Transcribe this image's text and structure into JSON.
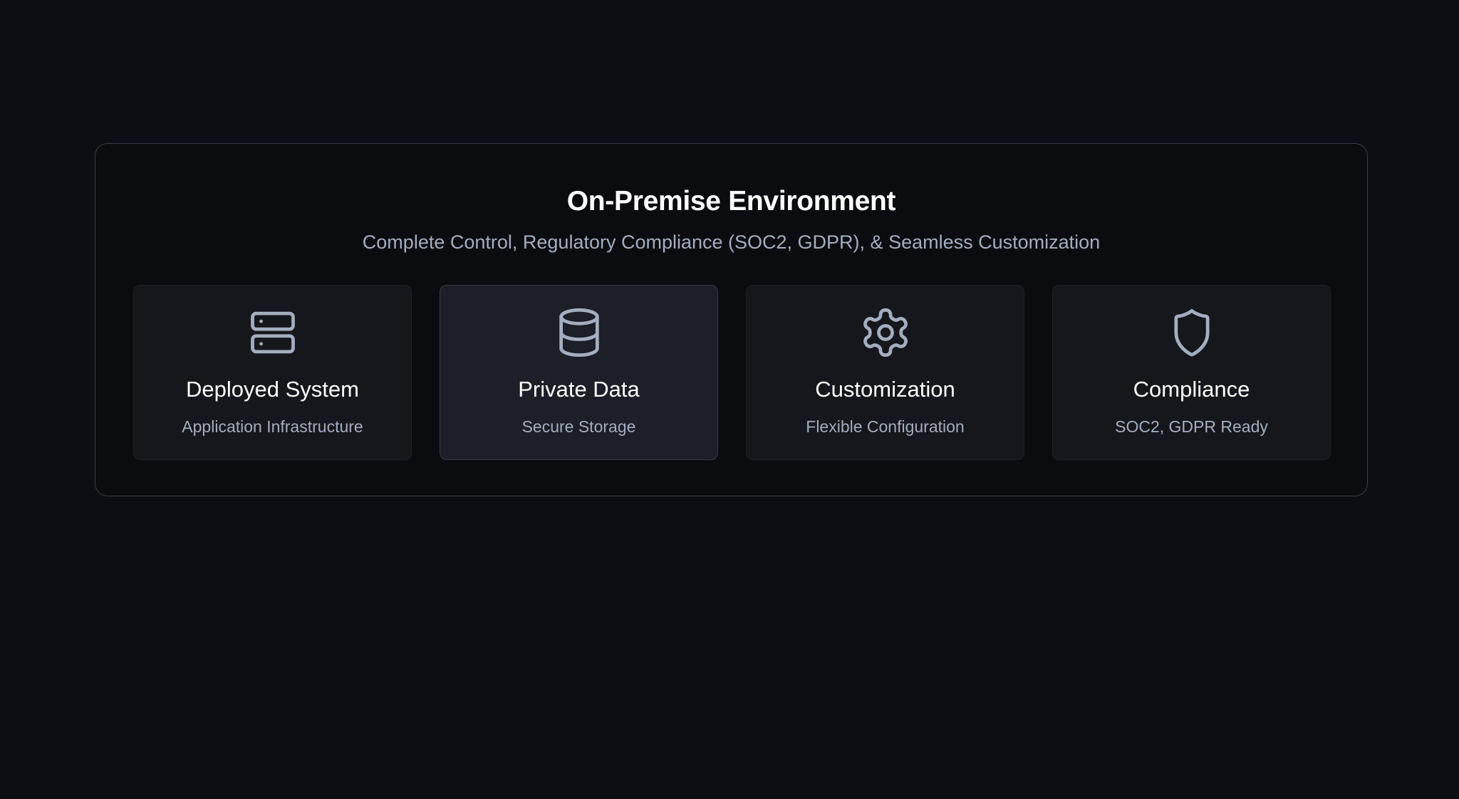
{
  "panel": {
    "title": "On-Premise Environment",
    "subtitle": "Complete Control, Regulatory Compliance (SOC2, GDPR), & Seamless Customization"
  },
  "cards": [
    {
      "icon": "server-icon",
      "title": "Deployed System",
      "subtitle": "Application Infrastructure"
    },
    {
      "icon": "database-icon",
      "title": "Private Data",
      "subtitle": "Secure Storage"
    },
    {
      "icon": "gear-icon",
      "title": "Customization",
      "subtitle": "Flexible Configuration"
    },
    {
      "icon": "shield-icon",
      "title": "Compliance",
      "subtitle": "SOC2, GDPR Ready"
    }
  ],
  "colors": {
    "background": "#0d0e13",
    "panel_border": "#3a3d46",
    "card_background": "#16171c",
    "card_active_background": "#1c1f27",
    "icon_stroke": "#a4aec0",
    "title_text": "#ffffff",
    "muted_text": "#a4aec0"
  }
}
